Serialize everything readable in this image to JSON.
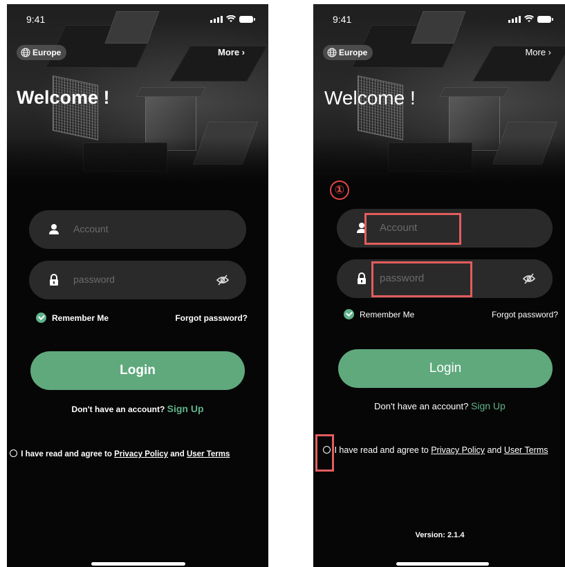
{
  "screens": [
    {
      "status": {
        "time": "9:41"
      },
      "region_label": "Europe",
      "more_label": "More ›",
      "welcome": "Welcome !",
      "account_placeholder": "Account",
      "password_placeholder": "password",
      "remember_label": "Remember Me",
      "forgot_label": "Forgot password?",
      "login_label": "Login",
      "no_account_text": "Don't have an account?",
      "sign_up_label": "Sign Up",
      "agree_text": "I have read and agree to",
      "privacy_label": "Privacy Policy",
      "and_text": "and",
      "terms_label": "User Terms"
    },
    {
      "status": {
        "time": "9:41"
      },
      "region_label": "Europe",
      "more_label": "More ›",
      "welcome": "Welcome !",
      "account_placeholder": "Account",
      "password_placeholder": "password",
      "remember_label": "Remember Me",
      "forgot_label": "Forgot password?",
      "login_label": "Login",
      "no_account_text": "Don't have an account?",
      "sign_up_label": "Sign Up",
      "agree_text": "I have read and agree to",
      "privacy_label": "Privacy Policy",
      "and_text": "and",
      "terms_label": "User Terms",
      "step_marker": "①",
      "version_text": "Version: 2.1.4"
    }
  ],
  "colors": {
    "accent_green": "#5fa97d",
    "highlight_red": "#e35d5d",
    "background": "#060606"
  },
  "icons": [
    "globe-icon",
    "user-icon",
    "lock-icon",
    "eye-off-icon",
    "check-circle-icon",
    "radio-icon"
  ]
}
